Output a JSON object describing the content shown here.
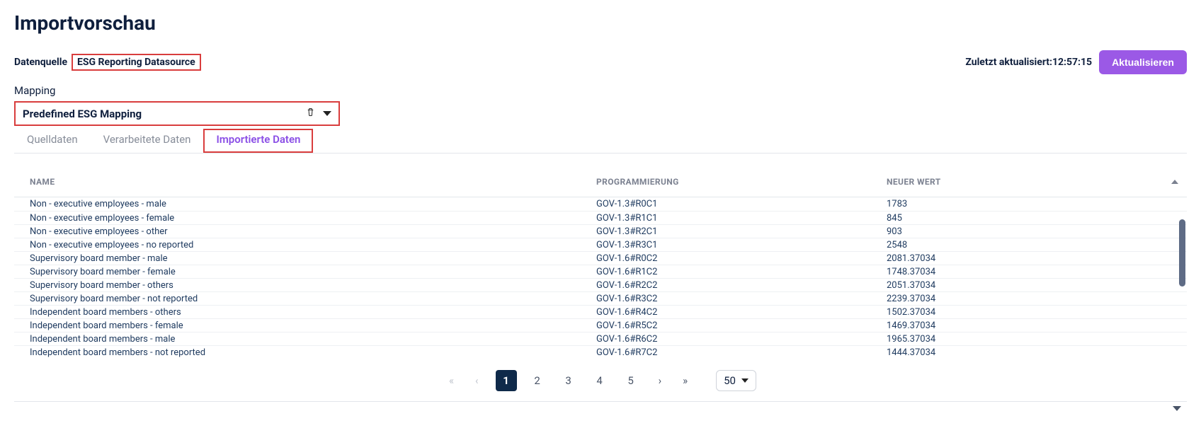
{
  "page_title": "Importvorschau",
  "datasource": {
    "label": "Datenquelle",
    "value": "ESG Reporting Datasource"
  },
  "updated": {
    "label": "Zuletzt aktualisiert:",
    "time": "12:57:15"
  },
  "refresh_button": "Aktualisieren",
  "mapping": {
    "label": "Mapping",
    "selected": "Predefined ESG Mapping"
  },
  "tabs": [
    {
      "label": "Quelldaten",
      "active": false
    },
    {
      "label": "Verarbeitete Daten",
      "active": false
    },
    {
      "label": "Importierte Daten",
      "active": true
    }
  ],
  "columns": {
    "name": "NAME",
    "prog": "PROGRAMMIERUNG",
    "newval": "NEUER WERT"
  },
  "rows": [
    {
      "name": "Non - executive employees - male",
      "prog": "GOV-1.3#R0C1",
      "val": "1783"
    },
    {
      "name": "Non - executive employees - female",
      "prog": "GOV-1.3#R1C1",
      "val": "845"
    },
    {
      "name": "Non - executive employees - other",
      "prog": "GOV-1.3#R2C1",
      "val": "903"
    },
    {
      "name": "Non - executive employees - no reported",
      "prog": "GOV-1.3#R3C1",
      "val": "2548"
    },
    {
      "name": "Supervisory board member - male",
      "prog": "GOV-1.6#R0C2",
      "val": "2081.37034"
    },
    {
      "name": "Supervisory board member - female",
      "prog": "GOV-1.6#R1C2",
      "val": "1748.37034"
    },
    {
      "name": "Supervisory board member - others",
      "prog": "GOV-1.6#R2C2",
      "val": "2051.37034"
    },
    {
      "name": "Supervisory board member - not reported",
      "prog": "GOV-1.6#R3C2",
      "val": "2239.37034"
    },
    {
      "name": "Independent board members - others",
      "prog": "GOV-1.6#R4C2",
      "val": "1502.37034"
    },
    {
      "name": "Independent board members - female",
      "prog": "GOV-1.6#R5C2",
      "val": "1469.37034"
    },
    {
      "name": "Independent board members - male",
      "prog": "GOV-1.6#R6C2",
      "val": "1965.37034"
    },
    {
      "name": "Independent board members - not reported",
      "prog": "GOV-1.6#R7C2",
      "val": "1444.37034"
    }
  ],
  "pagination": {
    "pages": [
      "1",
      "2",
      "3",
      "4",
      "5"
    ],
    "active": "1",
    "page_size": "50"
  }
}
